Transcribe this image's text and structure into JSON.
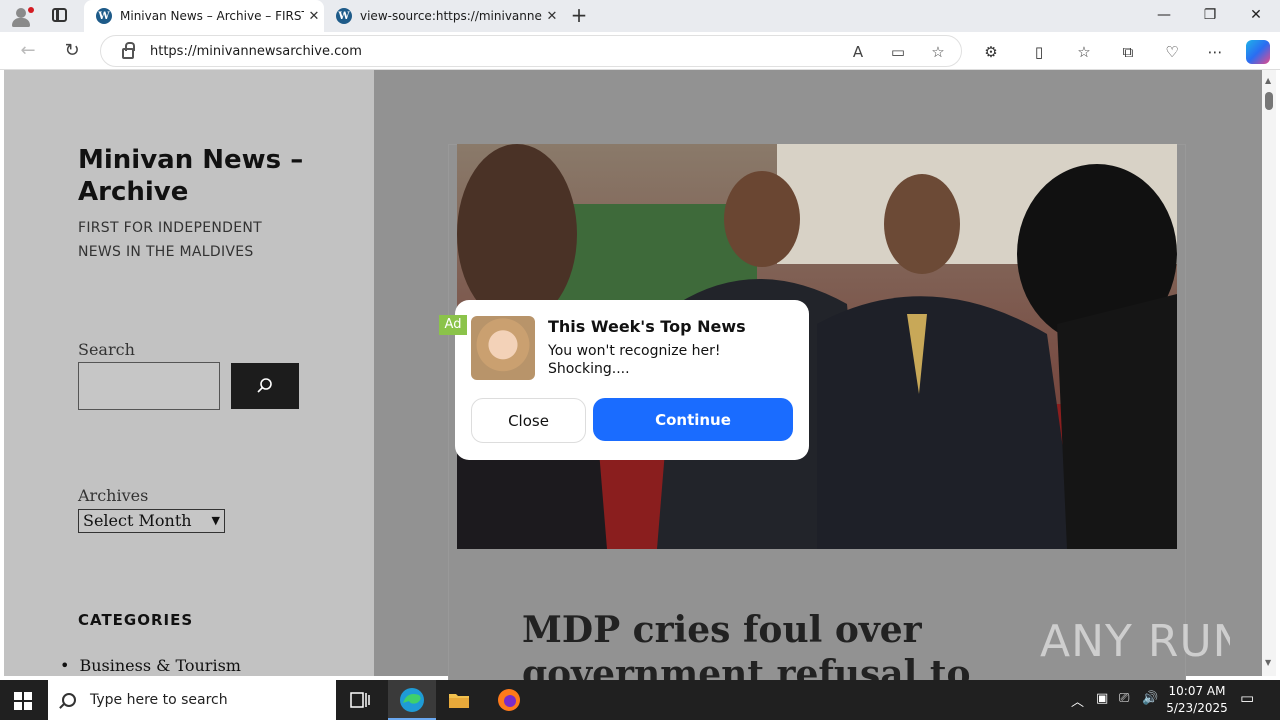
{
  "browser": {
    "tabs": [
      {
        "title": "Minivan News – Archive – FIRST F",
        "close": "✕"
      },
      {
        "title": "view-source:https://minivannew",
        "close": "✕"
      }
    ],
    "new_tab": "+",
    "window_controls": {
      "minimize": "—",
      "restore": "❐",
      "close": "✕"
    },
    "url": "https://minivannewsarchive.com"
  },
  "sidebar": {
    "site_title": "Minivan News – Archive",
    "site_description": "FIRST FOR INDEPENDENT NEWS IN THE MALDIVES",
    "search_label": "Search",
    "search_value": "",
    "archives_label": "Archives",
    "archives_select": "Select Month",
    "categories_label": "CATEGORIES",
    "categories": [
      "Business & Tourism"
    ]
  },
  "article": {
    "headline": "MDP cries foul over government refusal to"
  },
  "watermark": "ANY RUN",
  "ad": {
    "badge": "Ad",
    "title": "This Week's Top News",
    "text": "You won't recognize her! Shocking....",
    "close_label": "Close",
    "continue_label": "Continue",
    "accent": "#1a6cff",
    "badge_color": "#8bc34a"
  },
  "taskbar": {
    "search_placeholder": "Type here to search",
    "time": "10:07 AM",
    "date": "5/23/2025"
  },
  "colors": {
    "sidebar_bg": "#c2c2c2",
    "main_bg": "#929292",
    "taskbar_bg": "#202020"
  }
}
